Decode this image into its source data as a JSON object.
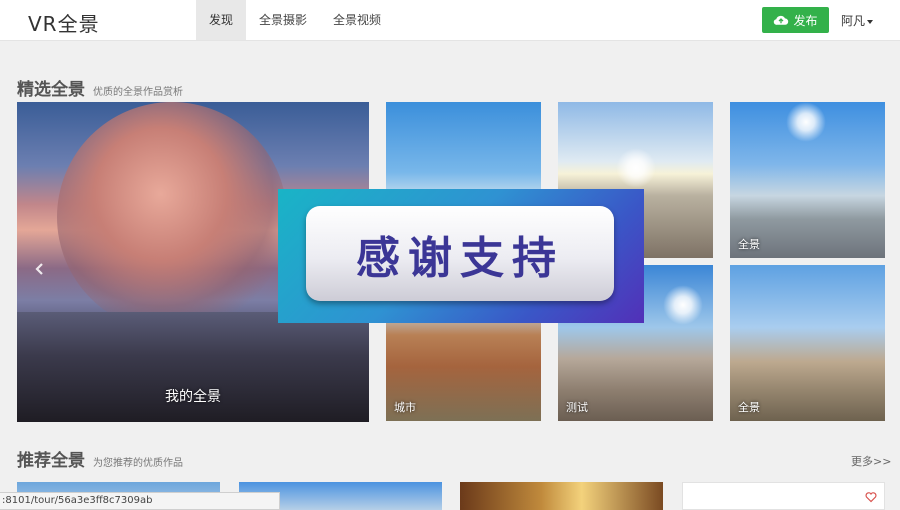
{
  "header": {
    "logo": "VR全景",
    "nav": [
      "发现",
      "全景摄影",
      "全景视频"
    ],
    "publish_label": "发布",
    "user": "阿凡"
  },
  "featured": {
    "title": "精选全景",
    "subtitle": "优质的全景作品赏析",
    "big_tile_label": "我的全景",
    "tiles": [
      {
        "label": ""
      },
      {
        "label": ""
      },
      {
        "label": "全景"
      },
      {
        "label": "城市"
      },
      {
        "label": "测试"
      },
      {
        "label": "全景"
      }
    ]
  },
  "overlay": {
    "text": "感谢支持"
  },
  "recommended": {
    "title": "推荐全景",
    "subtitle": "为您推荐的优质作品",
    "more": "更多>>"
  },
  "status_bar": {
    "url": ":8101/tour/56a3e3ff8c7309ab"
  },
  "colors": {
    "publish_green": "#33b14a",
    "overlay_text": "#3b3696"
  }
}
